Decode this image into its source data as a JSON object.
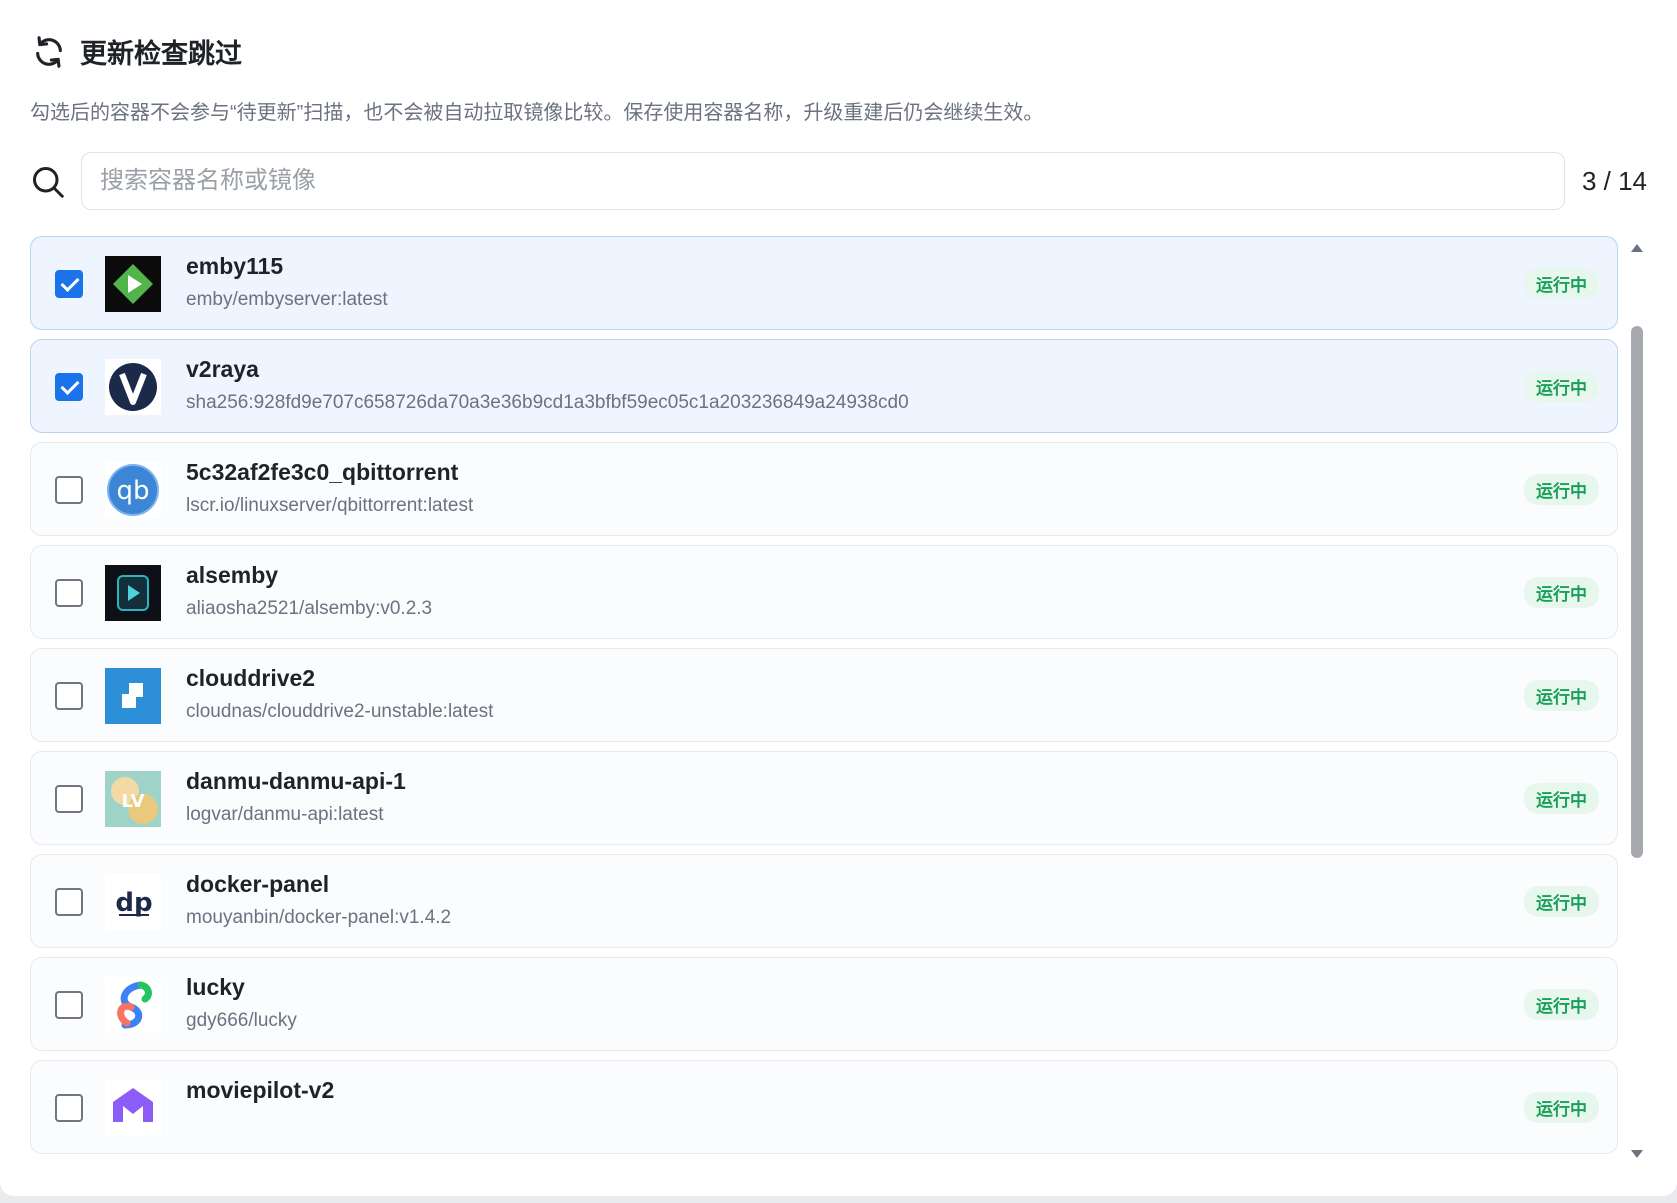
{
  "header": {
    "title": "更新检查跳过",
    "icon": "refresh-icon"
  },
  "description": "勾选后的容器不会参与“待更新”扫描，也不会被自动拉取镜像比较。保存使用容器名称，升级重建后仍会继续生效。",
  "search": {
    "placeholder": "搜索容器名称或镜像",
    "value": ""
  },
  "count": "3 / 14",
  "colors": {
    "accent": "#1a73e8",
    "running": "#18a058",
    "selected_bg": "#eef5ff"
  },
  "containers": [
    {
      "name": "emby115",
      "image": "emby/embyserver:latest",
      "status": "运行中",
      "checked": true,
      "logo": "emby-logo"
    },
    {
      "name": "v2raya",
      "image": "sha256:928fd9e707c658726da70a3e36b9cd1a3bfbf59ec05c1a203236849a24938cd0",
      "status": "运行中",
      "checked": true,
      "logo": "v2raya-logo"
    },
    {
      "name": "5c32af2fe3c0_qbittorrent",
      "image": "lscr.io/linuxserver/qbittorrent:latest",
      "status": "运行中",
      "checked": false,
      "logo": "qbittorrent-logo"
    },
    {
      "name": "alsemby",
      "image": "aliaosha2521/alsemby:v0.2.3",
      "status": "运行中",
      "checked": false,
      "logo": "alsemby-logo"
    },
    {
      "name": "clouddrive2",
      "image": "cloudnas/clouddrive2-unstable:latest",
      "status": "运行中",
      "checked": false,
      "logo": "clouddrive2-logo"
    },
    {
      "name": "danmu-danmu-api-1",
      "image": "logvar/danmu-api:latest",
      "status": "运行中",
      "checked": false,
      "logo": "danmu-logo"
    },
    {
      "name": "docker-panel",
      "image": "mouyanbin/docker-panel:v1.4.2",
      "status": "运行中",
      "checked": false,
      "logo": "docker-panel-logo"
    },
    {
      "name": "lucky",
      "image": "gdy666/lucky",
      "status": "运行中",
      "checked": false,
      "logo": "lucky-logo"
    },
    {
      "name": "moviepilot-v2",
      "image": "",
      "status": "运行中",
      "checked": false,
      "logo": "moviepilot-logo"
    }
  ]
}
